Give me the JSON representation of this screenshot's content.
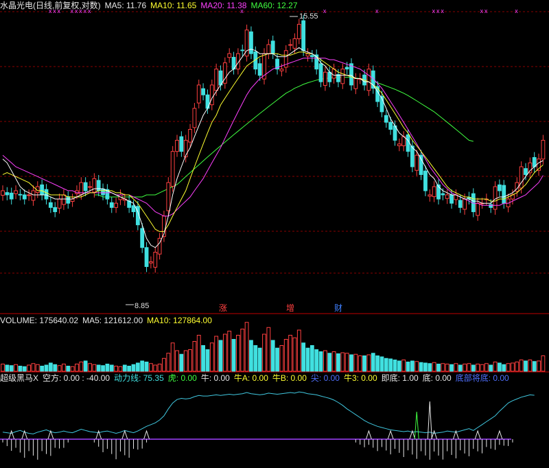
{
  "main_header": {
    "name": "水晶光电(日线,前复权,对数)",
    "ma5": "MA5: 11.76",
    "ma10": "MA10: 11.65",
    "ma20": "MA20: 11.38",
    "ma60": "MA60: 12.27"
  },
  "volume_header": {
    "volume": "VOLUME: 175640.02",
    "ma5": "MA5: 121612.00",
    "ma10": "MA10: 127864.00"
  },
  "indicator_header": {
    "name": "超级黑马X",
    "kongfang": "空方: 0.00 : -40.00",
    "dongli": "动力线: 75.35",
    "hu": "虎: 0.00",
    "niu": "牛: 0.00",
    "niu_a": "牛A: 0.00",
    "niu_b": "牛B: 0.00",
    "jian": "尖: 0.00",
    "niu3": "牛3: 0.00",
    "jidi": "即底: 1.00",
    "di": "底: 0.00",
    "dibu": "底部将底: 0.00"
  },
  "annotations": {
    "high_label": "15.55",
    "low_label": "8.85",
    "signal_zhang": "涨",
    "signal_zeng": "增",
    "signal_cai": "财"
  },
  "colors": {
    "up": "#ff4040",
    "down": "#40e0e0",
    "ma5": "#ffffff",
    "ma10": "#ffff30",
    "ma20": "#ff40ff",
    "ma60": "#40ff40",
    "grid": "#8a0000",
    "dongli": "#40c8e0"
  },
  "chart_data": {
    "type": "candlestick",
    "price_scale": "log",
    "price_range": [
      8.6,
      16.4
    ],
    "closes": [
      11.0,
      10.9,
      10.8,
      11.0,
      10.9,
      10.8,
      10.9,
      11.0,
      11.1,
      10.9,
      10.8,
      10.6,
      10.5,
      10.8,
      10.9,
      10.7,
      10.8,
      11.0,
      11.2,
      11.0,
      11.1,
      11.3,
      11.0,
      10.9,
      10.8,
      10.6,
      10.7,
      10.9,
      10.8,
      10.6,
      10.5,
      10.2,
      9.7,
      9.3,
      9.4,
      9.6,
      9.9,
      10.4,
      11.2,
      12.0,
      12.3,
      12.0,
      12.3,
      12.6,
      13.2,
      13.9,
      13.6,
      13.2,
      13.9,
      14.4,
      13.9,
      14.6,
      14.9,
      14.4,
      14.9,
      15.0,
      15.7,
      14.9,
      14.4,
      14.2,
      14.9,
      15.2,
      14.9,
      14.4,
      14.4,
      15.0,
      15.2,
      15.4,
      15.9,
      15.0,
      14.9,
      14.8,
      14.4,
      14.0,
      14.3,
      14.0,
      14.4,
      14.0,
      14.4,
      14.4,
      13.9,
      14.1,
      14.1,
      13.9,
      14.4,
      13.8,
      13.4,
      13.1,
      12.8,
      12.6,
      12.3,
      12.2,
      12.4,
      12.0,
      11.6,
      11.9,
      11.4,
      11.0,
      10.9,
      11.1,
      10.8,
      10.9,
      10.9,
      10.7,
      10.9,
      10.6,
      10.8,
      10.8,
      10.5,
      10.7,
      10.7,
      10.8,
      10.6,
      11.1,
      11.0,
      10.7,
      10.8,
      10.9,
      11.2,
      11.6,
      11.4,
      11.7,
      11.6,
      11.8,
      12.3
    ],
    "ma5": [
      11.8,
      11.7,
      11.5,
      11.3,
      11.1,
      11.0,
      10.95,
      10.9,
      10.9,
      10.9,
      10.9,
      10.85,
      10.8,
      10.8,
      10.8,
      10.8,
      10.8,
      10.85,
      10.9,
      10.95,
      11.0,
      11.05,
      11.05,
      11.05,
      11.0,
      10.95,
      10.9,
      10.85,
      10.8,
      10.75,
      10.7,
      10.5,
      10.2,
      9.9,
      9.75,
      9.7,
      9.8,
      10.0,
      10.4,
      10.9,
      11.3,
      11.6,
      11.9,
      12.1,
      12.4,
      12.7,
      13.0,
      13.2,
      13.5,
      13.7,
      13.9,
      14.1,
      14.3,
      14.4,
      14.6,
      14.8,
      15.0,
      15.05,
      15.0,
      14.9,
      14.9,
      14.9,
      14.9,
      14.8,
      14.8,
      14.8,
      14.9,
      15.0,
      15.1,
      15.0,
      14.95,
      14.9,
      14.8,
      14.6,
      14.5,
      14.3,
      14.2,
      14.2,
      14.2,
      14.2,
      14.2,
      14.1,
      14.1,
      14.0,
      14.0,
      13.9,
      13.7,
      13.5,
      13.2,
      12.9,
      12.7,
      12.5,
      12.4,
      12.3,
      12.1,
      12.0,
      11.8,
      11.6,
      11.4,
      11.3,
      11.1,
      11.0,
      10.95,
      10.9,
      10.9,
      10.85,
      10.8,
      10.8,
      10.75,
      10.75,
      10.7,
      10.7,
      10.7,
      10.8,
      10.85,
      10.85,
      10.9,
      10.95,
      11.05,
      11.2,
      11.35,
      11.5,
      11.6,
      11.7,
      11.76
    ],
    "ma10": [
      11.4,
      11.45,
      11.4,
      11.35,
      11.3,
      11.25,
      11.2,
      11.1,
      11.0,
      11.0,
      10.95,
      10.9,
      10.9,
      10.9,
      10.9,
      10.85,
      10.85,
      10.85,
      10.85,
      10.9,
      10.95,
      10.95,
      11.0,
      11.0,
      11.0,
      11.0,
      10.95,
      10.95,
      10.9,
      10.9,
      10.8,
      10.7,
      10.55,
      10.4,
      10.25,
      10.1,
      10.05,
      10.05,
      10.2,
      10.4,
      10.6,
      10.8,
      11.0,
      11.3,
      11.6,
      11.9,
      12.2,
      12.5,
      12.8,
      13.0,
      13.3,
      13.5,
      13.7,
      13.9,
      14.1,
      14.3,
      14.5,
      14.6,
      14.7,
      14.8,
      14.85,
      14.9,
      14.9,
      14.9,
      14.85,
      14.85,
      14.85,
      14.9,
      14.95,
      14.95,
      14.9,
      14.9,
      14.8,
      14.7,
      14.6,
      14.5,
      14.4,
      14.3,
      14.25,
      14.2,
      14.15,
      14.1,
      14.1,
      14.05,
      14.0,
      13.9,
      13.8,
      13.65,
      13.45,
      13.25,
      13.05,
      12.85,
      12.65,
      12.5,
      12.3,
      12.15,
      12.0,
      11.85,
      11.7,
      11.55,
      11.4,
      11.25,
      11.1,
      11.0,
      10.95,
      10.9,
      10.85,
      10.85,
      10.8,
      10.8,
      10.8,
      10.8,
      10.75,
      10.75,
      10.8,
      10.8,
      10.85,
      10.9,
      10.95,
      11.05,
      11.15,
      11.3,
      11.45,
      11.55,
      11.65
    ],
    "ma20": [
      11.9,
      11.8,
      11.7,
      11.6,
      11.55,
      11.5,
      11.45,
      11.4,
      11.35,
      11.3,
      11.25,
      11.2,
      11.15,
      11.1,
      11.05,
      11.0,
      11.0,
      10.95,
      10.95,
      10.95,
      10.95,
      10.95,
      10.95,
      10.95,
      10.95,
      10.95,
      10.9,
      10.9,
      10.9,
      10.9,
      10.85,
      10.8,
      10.75,
      10.7,
      10.6,
      10.5,
      10.45,
      10.4,
      10.4,
      10.45,
      10.55,
      10.65,
      10.75,
      10.85,
      11.0,
      11.15,
      11.3,
      11.5,
      11.7,
      11.9,
      12.1,
      12.35,
      12.6,
      12.85,
      13.1,
      13.35,
      13.6,
      13.8,
      13.95,
      14.1,
      14.2,
      14.3,
      14.4,
      14.45,
      14.5,
      14.55,
      14.6,
      14.65,
      14.7,
      14.75,
      14.75,
      14.75,
      14.75,
      14.75,
      14.75,
      14.7,
      14.7,
      14.65,
      14.6,
      14.55,
      14.5,
      14.45,
      14.4,
      14.3,
      14.2,
      14.1,
      13.95,
      13.8,
      13.6,
      13.4,
      13.2,
      13.0,
      12.8,
      12.6,
      12.4,
      12.2,
      12.0,
      11.8,
      11.6,
      11.45,
      11.3,
      11.15,
      11.05,
      10.95,
      10.9,
      10.85,
      10.8,
      10.75,
      10.7,
      10.7,
      10.65,
      10.65,
      10.65,
      10.65,
      10.65,
      10.7,
      10.7,
      10.75,
      10.8,
      10.85,
      10.9,
      11.0,
      11.1,
      11.2,
      11.38
    ],
    "ma60_start": 21,
    "ma60": [
      10.9,
      10.9,
      10.85,
      10.85,
      10.85,
      10.85,
      10.85,
      10.85,
      10.85,
      10.85,
      10.85,
      10.85,
      10.9,
      10.9,
      10.9,
      10.95,
      11.0,
      11.05,
      11.1,
      11.15,
      11.25,
      11.35,
      11.45,
      11.55,
      11.65,
      11.75,
      11.85,
      11.95,
      12.05,
      12.15,
      12.25,
      12.35,
      12.45,
      12.55,
      12.65,
      12.75,
      12.85,
      12.95,
      13.05,
      13.15,
      13.25,
      13.35,
      13.45,
      13.55,
      13.65,
      13.72,
      13.8,
      13.86,
      13.92,
      13.97,
      14.01,
      14.05,
      14.08,
      14.1,
      14.12,
      14.13,
      14.14,
      14.14,
      14.14,
      14.13,
      14.12,
      14.1,
      14.08,
      14.05,
      14.01,
      13.97,
      13.92,
      13.87,
      13.82,
      13.77,
      13.71,
      13.65,
      13.58,
      13.5,
      13.42,
      13.34,
      13.26,
      13.18,
      13.1,
      13.0,
      12.9,
      12.8,
      12.7,
      12.6,
      12.5,
      12.4,
      12.3,
      12.27
    ],
    "volume_range": [
      0,
      300000
    ],
    "volume_scale_heights": [
      0.14,
      0.12,
      0.11,
      0.13,
      0.1,
      0.09,
      0.12,
      0.15,
      0.13,
      0.1,
      0.12,
      0.16,
      0.13,
      0.11,
      0.14,
      0.1,
      0.09,
      0.14,
      0.18,
      0.2,
      0.15,
      0.13,
      0.12,
      0.11,
      0.14,
      0.12,
      0.1,
      0.09,
      0.12,
      0.1,
      0.13,
      0.16,
      0.2,
      0.18,
      0.15,
      0.12,
      0.14,
      0.25,
      0.35,
      0.55,
      0.4,
      0.33,
      0.4,
      0.42,
      0.58,
      0.7,
      0.5,
      0.42,
      0.55,
      0.68,
      0.6,
      0.72,
      0.78,
      0.62,
      0.7,
      0.82,
      0.95,
      0.6,
      0.5,
      0.45,
      0.72,
      0.85,
      0.6,
      0.45,
      0.5,
      0.62,
      0.7,
      0.65,
      0.8,
      0.55,
      0.45,
      0.5,
      0.42,
      0.38,
      0.4,
      0.35,
      0.38,
      0.34,
      0.36,
      0.35,
      0.32,
      0.33,
      0.3,
      0.3,
      0.32,
      0.35,
      0.3,
      0.28,
      0.25,
      0.24,
      0.22,
      0.2,
      0.22,
      0.18,
      0.2,
      0.19,
      0.17,
      0.16,
      0.15,
      0.17,
      0.14,
      0.15,
      0.14,
      0.13,
      0.15,
      0.12,
      0.14,
      0.15,
      0.12,
      0.14,
      0.13,
      0.15,
      0.12,
      0.18,
      0.16,
      0.13,
      0.15,
      0.16,
      0.18,
      0.22,
      0.2,
      0.22,
      0.19,
      0.2,
      0.3
    ],
    "dongli_line": [
      12,
      11,
      10,
      13,
      15,
      12,
      10,
      9,
      12,
      14,
      16,
      13,
      11,
      12,
      14,
      12,
      11,
      14,
      17,
      15,
      13,
      12,
      11,
      13,
      14,
      12,
      10,
      12,
      15,
      13,
      11,
      14,
      18,
      22,
      25,
      28,
      33,
      40,
      52,
      62,
      68,
      70,
      69,
      70,
      73,
      75,
      74,
      74,
      75,
      76,
      75,
      76,
      77,
      76,
      77,
      78,
      80,
      78,
      77,
      76,
      77,
      79,
      78,
      77,
      78,
      79,
      80,
      79,
      81,
      80,
      78,
      77,
      76,
      74,
      72,
      70,
      67,
      63,
      58,
      52,
      47,
      42,
      37,
      32,
      28,
      25,
      22,
      20,
      18,
      16,
      15,
      14,
      13,
      14,
      12,
      13,
      12,
      11,
      12,
      10,
      11,
      12,
      14,
      13,
      12,
      14,
      16,
      18,
      15,
      20,
      25,
      30,
      35,
      40,
      48,
      55,
      62,
      66,
      69,
      72,
      74,
      76,
      75.35
    ]
  }
}
